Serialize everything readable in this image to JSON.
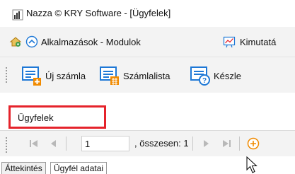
{
  "window": {
    "title": "Nazza © KRY Software - [Ügyfelek]",
    "app_icon": "bar-chart-app-icon"
  },
  "menubar": {
    "items": [
      {
        "label": "",
        "icon": "home-settings-icon"
      },
      {
        "label": "Alkalmazások - Modulok",
        "icon": "circle-up-chevron-icon"
      },
      {
        "label": "Kimutatá",
        "icon": "chart-report-icon"
      }
    ]
  },
  "toolbar": {
    "buttons": [
      {
        "label": "Új számla",
        "icon": "new-invoice-icon"
      },
      {
        "label": "Számlalista",
        "icon": "invoice-list-icon"
      },
      {
        "label": "Készle",
        "icon": "inventory-help-icon"
      }
    ]
  },
  "document_tab": {
    "label": "Ügyfelek",
    "highlight_color": "#e5232b"
  },
  "navigator": {
    "current_page": "1",
    "total_label": ", összesen: 1",
    "add_icon": "add-circle-icon",
    "add_color": "#f08a00"
  },
  "bottom_tabs": [
    {
      "label": "Áttekintés",
      "active": false
    },
    {
      "label": "Ügyfél adatai",
      "active": true
    }
  ],
  "colors": {
    "toolbar_bg": "#f3f3f3",
    "accent_blue": "#1e78d6",
    "accent_orange": "#f08a00"
  }
}
